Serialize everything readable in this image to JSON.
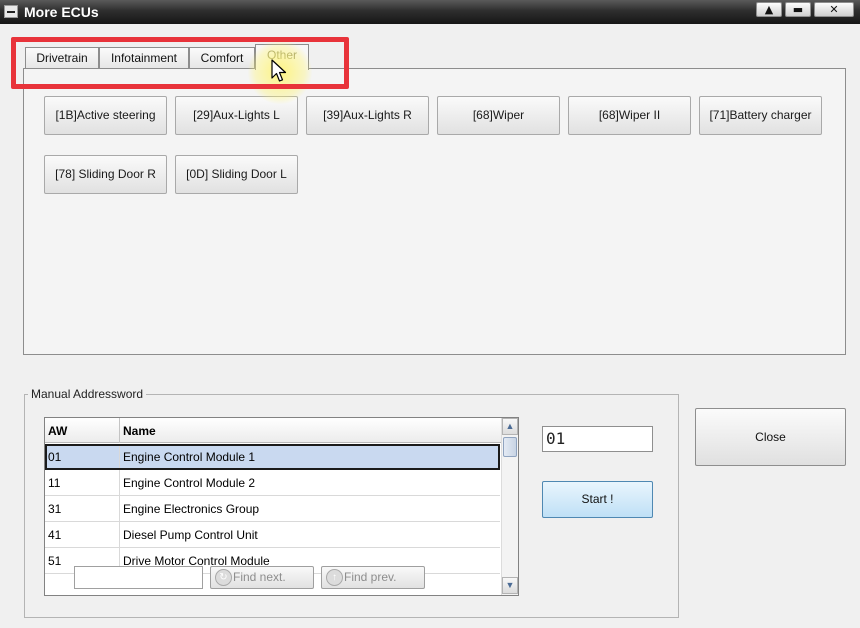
{
  "window": {
    "title": "More ECUs",
    "controls": {
      "minimize": "▲",
      "maximize": "▬",
      "close": "✕"
    }
  },
  "tabs": [
    {
      "label": "Drivetrain",
      "active": false
    },
    {
      "label": "Infotainment",
      "active": false
    },
    {
      "label": "Comfort",
      "active": false
    },
    {
      "label": "Other",
      "active": true
    }
  ],
  "ecu_buttons": [
    "[1B]Active steering",
    "[29]Aux-Lights  L",
    "[39]Aux-Lights  R",
    "[68]Wiper",
    "[68]Wiper II",
    "[71]Battery charger",
    "[78] Sliding Door R",
    "[0D] Sliding Door L"
  ],
  "manual": {
    "group_label": "Manual Addressword",
    "columns": {
      "aw": "AW",
      "name": "Name"
    },
    "rows": [
      {
        "aw": "01",
        "name": "Engine Control Module 1"
      },
      {
        "aw": "11",
        "name": "Engine Control Module 2"
      },
      {
        "aw": "31",
        "name": "Engine Electronics Group"
      },
      {
        "aw": "41",
        "name": "Diesel Pump Control Unit"
      },
      {
        "aw": "51",
        "name": "Drive Motor Control Module"
      }
    ],
    "selected_index": 0,
    "find_placeholder": "",
    "find_next_label": "Find next.",
    "find_prev_label": "Find prev.",
    "address_value": "01",
    "start_label": "Start !"
  },
  "close_label": "Close",
  "icons": {
    "scroll_up": "▲",
    "scroll_down": "▼",
    "find_next_icon": "↻",
    "find_prev_icon": "↑"
  },
  "colors": {
    "highlight": "#e8333a",
    "selection": "#c9d9f0",
    "start_button": "#bfe0f6"
  }
}
